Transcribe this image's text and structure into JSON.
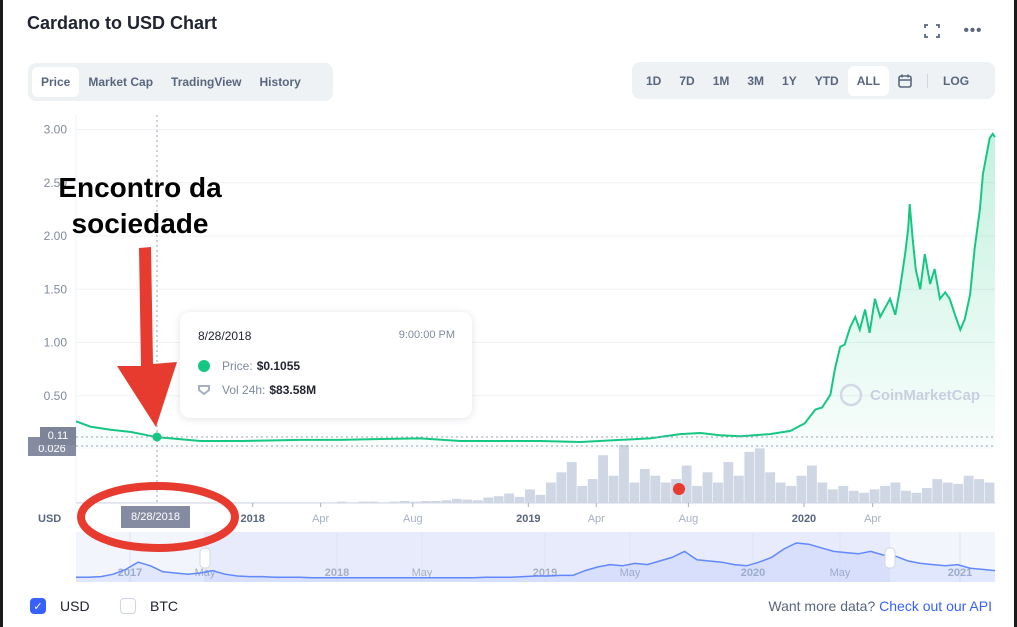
{
  "header": {
    "title": "Cardano to USD Chart",
    "fullscreen_icon": "fullscreen-icon",
    "more_icon": "more-horizontal-icon"
  },
  "tabs": [
    {
      "label": "Price",
      "active": true
    },
    {
      "label": "Market Cap",
      "active": false
    },
    {
      "label": "TradingView",
      "active": false
    },
    {
      "label": "History",
      "active": false
    }
  ],
  "ranges": [
    {
      "label": "1D",
      "active": false
    },
    {
      "label": "7D",
      "active": false
    },
    {
      "label": "1M",
      "active": false
    },
    {
      "label": "3M",
      "active": false
    },
    {
      "label": "1Y",
      "active": false
    },
    {
      "label": "YTD",
      "active": false
    },
    {
      "label": "ALL",
      "active": true
    }
  ],
  "calendar_icon": "calendar-icon",
  "log_label": "LOG",
  "tooltip": {
    "date": "8/28/2018",
    "time": "9:00:00 PM",
    "price_label": "Price:",
    "price_value": "$0.1055",
    "vol_label": "Vol 24h:",
    "vol_value": "$83.58M"
  },
  "crosshair": {
    "price_label": "0.11",
    "min_label": "0.026",
    "date_label": "8/28/2018"
  },
  "watermark": "CoinMarketCap",
  "annotation": {
    "line1": "Encontro da",
    "line2": "sociedade"
  },
  "currencies": [
    {
      "label": "USD",
      "checked": true
    },
    {
      "label": "BTC",
      "checked": false
    }
  ],
  "footer": {
    "text": "Want more data?",
    "link": "Check out our API"
  },
  "colors": {
    "price_line": "#16c784",
    "volume": "#cfd6e4",
    "navigator": "#6188ff",
    "accent": "#3861fb",
    "annotation": "#e63b2e"
  },
  "chart_data": {
    "type": "area",
    "ylabel": "USD",
    "ylim": [
      0,
      3.0
    ],
    "yticks": [
      "0.50",
      "1.00",
      "1.50",
      "2.00",
      "2.50",
      "3.00"
    ],
    "xticks": [
      {
        "label": "2018",
        "date": "2018-01-01",
        "bold": true
      },
      {
        "label": "Apr",
        "date": "2018-04-01",
        "bold": false
      },
      {
        "label": "Aug",
        "date": "2018-08-01",
        "bold": false
      },
      {
        "label": "2019",
        "date": "2019-01-01",
        "bold": true
      },
      {
        "label": "Apr",
        "date": "2019-04-01",
        "bold": false
      },
      {
        "label": "Aug",
        "date": "2019-08-01",
        "bold": false
      },
      {
        "label": "2020",
        "date": "2020-01-01",
        "bold": true
      },
      {
        "label": "Apr",
        "date": "2020-04-01",
        "bold": false
      }
    ],
    "xlim": [
      "2017-05-12",
      "2020-09-10"
    ],
    "grid": true,
    "series": [
      {
        "points": [
          [
            "2017-05-12",
            0.26
          ],
          [
            "2017-05-31",
            0.21
          ],
          [
            "2017-06-27",
            0.18
          ],
          [
            "2017-07-24",
            0.16
          ],
          [
            "2017-08-28",
            0.11
          ],
          [
            "2017-09-15",
            0.1
          ],
          [
            "2017-10-24",
            0.075
          ],
          [
            "2017-12-16",
            0.075
          ],
          [
            "2018-03-05",
            0.085
          ],
          [
            "2018-04-27",
            0.085
          ],
          [
            "2018-06-19",
            0.094
          ],
          [
            "2018-08-11",
            0.1
          ],
          [
            "2018-10-03",
            0.075
          ],
          [
            "2018-11-25",
            0.075
          ],
          [
            "2019-01-17",
            0.075
          ],
          [
            "2019-03-11",
            0.066
          ],
          [
            "2019-05-03",
            0.085
          ],
          [
            "2019-06-11",
            0.1
          ],
          [
            "2019-07-21",
            0.14
          ],
          [
            "2019-08-17",
            0.15
          ],
          [
            "2019-09-12",
            0.13
          ],
          [
            "2019-10-09",
            0.12
          ],
          [
            "2019-11-17",
            0.14
          ],
          [
            "2019-12-14",
            0.17
          ],
          [
            "2020-01-02",
            0.24
          ],
          [
            "2020-01-16",
            0.37
          ],
          [
            "2020-01-25",
            0.39
          ],
          [
            "2020-02-05",
            0.51
          ],
          [
            "2020-02-11",
            0.75
          ],
          [
            "2020-02-18",
            0.96
          ],
          [
            "2020-02-24",
            0.98
          ],
          [
            "2020-03-02",
            1.14
          ],
          [
            "2020-03-09",
            1.24
          ],
          [
            "2020-03-15",
            1.12
          ],
          [
            "2020-03-22",
            1.31
          ],
          [
            "2020-03-28",
            1.09
          ],
          [
            "2020-04-04",
            1.41
          ],
          [
            "2020-04-11",
            1.24
          ],
          [
            "2020-04-24",
            1.41
          ],
          [
            "2020-05-01",
            1.26
          ],
          [
            "2020-05-07",
            1.5
          ],
          [
            "2020-05-14",
            1.83
          ],
          [
            "2020-05-18",
            2.07
          ],
          [
            "2020-05-20",
            2.3
          ],
          [
            "2020-05-24",
            1.97
          ],
          [
            "2020-05-28",
            1.69
          ],
          [
            "2020-06-03",
            1.5
          ],
          [
            "2020-06-09",
            1.83
          ],
          [
            "2020-06-16",
            1.55
          ],
          [
            "2020-06-22",
            1.69
          ],
          [
            "2020-06-29",
            1.41
          ],
          [
            "2020-07-06",
            1.47
          ],
          [
            "2020-07-12",
            1.41
          ],
          [
            "2020-07-19",
            1.26
          ],
          [
            "2020-07-26",
            1.12
          ],
          [
            "2020-08-01",
            1.22
          ],
          [
            "2020-08-08",
            1.45
          ],
          [
            "2020-08-14",
            1.88
          ],
          [
            "2020-08-21",
            2.25
          ],
          [
            "2020-08-25",
            2.58
          ],
          [
            "2020-08-30",
            2.77
          ],
          [
            "2020-09-03",
            2.92
          ],
          [
            "2020-09-07",
            2.96
          ],
          [
            "2020-09-10",
            2.93
          ]
        ]
      }
    ],
    "volume_relative": [
      1,
      1,
      1,
      1,
      1,
      1,
      1,
      1,
      1,
      1,
      1,
      1,
      1,
      1,
      1,
      1,
      1,
      1,
      1,
      1,
      1,
      1,
      1,
      1,
      1,
      2,
      1,
      2,
      2,
      1,
      2,
      3,
      2,
      3,
      3,
      4,
      6,
      5,
      4,
      8,
      10,
      14,
      9,
      20,
      12,
      30,
      45,
      60,
      25,
      35,
      70,
      40,
      85,
      30,
      50,
      40,
      30,
      35,
      55,
      25,
      45,
      30,
      60,
      40,
      75,
      80,
      45,
      30,
      25,
      40,
      55,
      30,
      20,
      25,
      18,
      15,
      20,
      25,
      30,
      18,
      15,
      22,
      35,
      30,
      28,
      40,
      35,
      30
    ],
    "navigator": {
      "labels": [
        {
          "label": "2017",
          "bold": true
        },
        {
          "label": "May",
          "bold": false
        },
        {
          "label": "2018",
          "bold": true
        },
        {
          "label": "May",
          "bold": false
        },
        {
          "label": "2019",
          "bold": true
        },
        {
          "label": "May",
          "bold": false
        },
        {
          "label": "2020",
          "bold": true
        },
        {
          "label": "May",
          "bold": false
        },
        {
          "label": "2021",
          "bold": true
        }
      ],
      "values_relative": [
        3,
        3,
        4,
        8,
        16,
        28,
        22,
        12,
        10,
        8,
        10,
        14,
        8,
        5,
        4,
        4,
        3,
        3,
        3,
        2,
        2,
        2,
        2,
        2,
        2,
        2,
        2,
        2,
        2,
        2,
        2,
        2,
        2,
        3,
        3,
        3,
        4,
        5,
        5,
        6,
        6,
        14,
        20,
        24,
        22,
        26,
        24,
        30,
        36,
        46,
        32,
        30,
        28,
        24,
        22,
        28,
        36,
        50,
        60,
        58,
        52,
        46,
        44,
        42,
        46,
        40,
        38,
        30,
        26,
        24,
        22,
        24,
        18,
        16,
        14
      ]
    }
  }
}
